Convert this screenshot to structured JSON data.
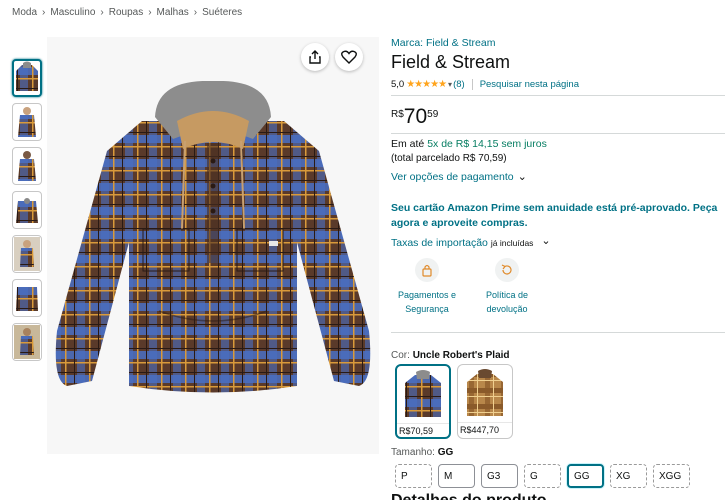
{
  "breadcrumb": [
    "Moda",
    "Masculino",
    "Roupas",
    "Malhas",
    "Suéteres"
  ],
  "breadcrumb_sep": "›",
  "brand_link": "Marca: Field & Stream",
  "title": "Field & Stream",
  "rating": {
    "value": "5,0",
    "stars": "★★★★★",
    "count": "(8)",
    "search_link": "Pesquisar nesta página"
  },
  "price": {
    "currency": "R$",
    "whole": "70",
    "fraction": "59"
  },
  "installments": {
    "prefix": "Em até ",
    "highlight": "5x de R$ 14,15 sem juros",
    "total": "(total parcelado R$ 70,59)"
  },
  "payment_options": "Ver opções de pagamento",
  "prime_offer": "Seu cartão Amazon Prime sem anuidade está pré-aprovado. Peça agora e aproveite compras.",
  "import_taxes": {
    "link": "Taxas de importação",
    "suffix": "já incluídas"
  },
  "features": [
    {
      "label": "Pagamentos e Segurança",
      "icon": "lock-icon"
    },
    {
      "label": "Política de devolução",
      "icon": "return-icon"
    }
  ],
  "color": {
    "label": "Cor:",
    "value": "Uncle Robert's Plaid"
  },
  "swatches": [
    {
      "price": "R$70,59",
      "selected": true
    },
    {
      "price": "R$447,70",
      "selected": false
    }
  ],
  "size": {
    "label": "Tamanho:",
    "value": "GG"
  },
  "sizes": [
    "P",
    "M",
    "G3",
    "G",
    "GG",
    "XG",
    "XGG"
  ],
  "details_heading": "Detalhes do produto",
  "colors": {
    "link": "#007185",
    "green": "#067d62",
    "star": "#ffa41c",
    "plaid_blue": "#4a6fc4",
    "plaid_brown": "#5a3a2a"
  }
}
